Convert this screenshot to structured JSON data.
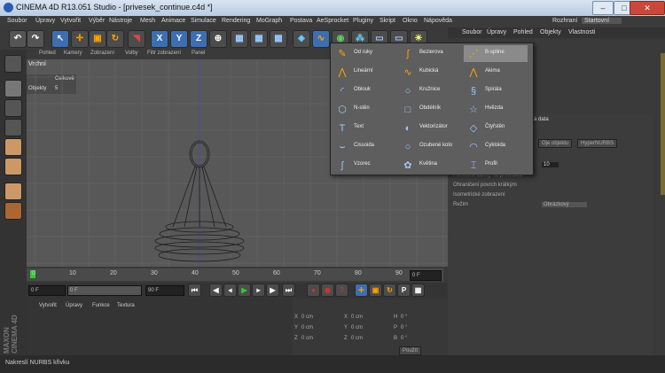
{
  "window": {
    "title": "CINEMA 4D R13.051 Studio - [privesek_continue.c4d *]"
  },
  "menu": [
    "Soubor",
    "Úpravy",
    "Vytvořit",
    "Výběr",
    "Nástroje",
    "Mesh",
    "Animace",
    "Simulace",
    "Rendering",
    "MoGraph",
    "Postava",
    "AeSprocket",
    "Pluginy",
    "Skript",
    "Okno",
    "Nápověda"
  ],
  "layout": {
    "label": "Rozhraní",
    "value": "Startovní"
  },
  "toolbar": {
    "x": "X",
    "y": "Y",
    "z": "Z"
  },
  "viewport": {
    "menu": [
      "Pohled",
      "Kamery",
      "Zobrazení",
      "Volby",
      "Filtr zobrazení",
      "Panel"
    ],
    "label": "Vrchní",
    "stats_title": "Celkově",
    "stats_label": "Objekty",
    "stats_value": "5"
  },
  "timeline": {
    "ticks": [
      "0",
      "10",
      "20",
      "30",
      "40",
      "50",
      "60",
      "70",
      "80",
      "90"
    ],
    "start": "0 F",
    "current": "0 F",
    "end": "90 F",
    "frame_end": "90 F",
    "right_field": "0 F"
  },
  "material_menu": [
    "Vytvořit",
    "Úpravy",
    "Funkce",
    "Textura"
  ],
  "coords": {
    "rows": [
      {
        "axis": "X",
        "val": "0 cm",
        "axis2": "X",
        "val2": "0 cm",
        "axis3": "H",
        "val3": "0 °"
      },
      {
        "axis": "Y",
        "val": "0 cm",
        "axis2": "Y",
        "val2": "0 cm",
        "axis3": "P",
        "val3": "0 °"
      },
      {
        "axis": "Z",
        "val": "0 cm",
        "axis2": "Z",
        "val2": "0 cm",
        "axis3": "B",
        "val3": "0 °"
      }
    ],
    "apply": "Použít"
  },
  "object_manager": {
    "menu": [
      "Soubor",
      "Úpravy",
      "Pohled",
      "Objekty",
      "Vlastnosti"
    ]
  },
  "attributes": {
    "header": "ká data",
    "tabs": [
      "Oje objektu",
      "HyperNURBS"
    ],
    "rows": [
      {
        "label": "",
        "value": "10"
      },
      {
        "label": "Pomocné zářivy na přechodu",
        "value": ""
      },
      {
        "label": "Ohraničení povrch krátkým",
        "value": ""
      },
      {
        "label": "Isometrické zobrazení",
        "value": ""
      },
      {
        "label": "Režim",
        "value": "Obrázkový"
      }
    ]
  },
  "spline_menu": {
    "col1": [
      {
        "label": "Od ruky",
        "icon": "freehand-spline-icon"
      },
      {
        "label": "Lineární",
        "icon": "linear-spline-icon"
      },
      {
        "label": "Oblouk",
        "icon": "arc-spline-icon"
      },
      {
        "label": "N-stěn",
        "icon": "n-side-spline-icon"
      },
      {
        "label": "Text",
        "icon": "text-spline-icon"
      },
      {
        "label": "Cissoida",
        "icon": "cissoid-spline-icon"
      },
      {
        "label": "Vzorec",
        "icon": "formula-spline-icon"
      }
    ],
    "col2": [
      {
        "label": "Bezierova",
        "icon": "bezier-spline-icon"
      },
      {
        "label": "Kubická",
        "icon": "cubic-spline-icon"
      },
      {
        "label": "Kružnice",
        "icon": "circle-spline-icon"
      },
      {
        "label": "Obdélník",
        "icon": "rectangle-spline-icon"
      },
      {
        "label": "Vektorizátor",
        "icon": "vectorizer-spline-icon"
      },
      {
        "label": "Ozubené kolo",
        "icon": "cogwheel-spline-icon"
      },
      {
        "label": "Květina",
        "icon": "flower-spline-icon"
      }
    ],
    "col3": [
      {
        "label": "B-spline",
        "icon": "b-spline-icon"
      },
      {
        "label": "Akima",
        "icon": "akima-spline-icon"
      },
      {
        "label": "Spirála",
        "icon": "helix-spline-icon"
      },
      {
        "label": "Hvězda",
        "icon": "star-spline-icon"
      },
      {
        "label": "Čtyřstěn",
        "icon": "four-side-spline-icon"
      },
      {
        "label": "Cykloida",
        "icon": "cycloid-spline-icon"
      },
      {
        "label": "Profil",
        "icon": "profile-spline-icon"
      }
    ]
  },
  "brand": {
    "line1": "MAXON",
    "line2": "CINEMA 4D"
  },
  "status": {
    "text": "Nakreslí NURBS křivku"
  }
}
